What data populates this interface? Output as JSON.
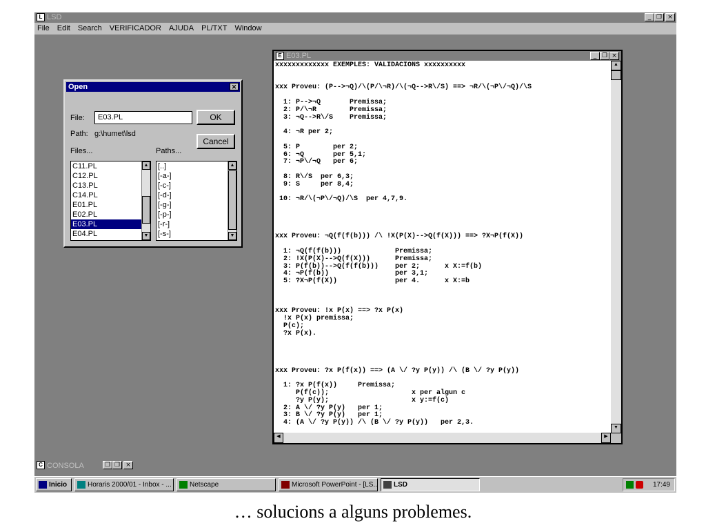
{
  "app": {
    "title": "LSD",
    "window_buttons": [
      "_",
      "❐",
      "×"
    ]
  },
  "menu": [
    "File",
    "Edit",
    "Search",
    "VERIFICADOR",
    "AJUDA",
    "PL/TXT",
    "Window"
  ],
  "open_dialog": {
    "title": "Open",
    "file_label": "File:",
    "file_value": "E03.PL",
    "path_label": "Path:",
    "path_value": "g:\\humet\\lsd",
    "files_label": "Files...",
    "paths_label": "Paths...",
    "ok_label": "OK",
    "cancel_label": "Cancel",
    "files": [
      "C11.PL",
      "C12.PL",
      "C13.PL",
      "C14.PL",
      "E01.PL",
      "E02.PL",
      "E03.PL",
      "E04.PL"
    ],
    "selected_file": "E03.PL",
    "paths": [
      "[..]",
      "[-a-]",
      "[-c-]",
      "[-d-]",
      "[-g-]",
      "[-p-]",
      "[-r-]",
      "[-s-]"
    ]
  },
  "editor": {
    "title": "E03.PL",
    "lines": [
      "xxxxxxxxxxxxx EXEMPLES: VALIDACIONS xxxxxxxxxx",
      "",
      "",
      "xxx Proveu: (P-->¬Q)/\\(P/\\¬R)/\\(¬Q-->R\\/S) ==> ¬R/\\(¬P\\/¬Q)/\\S",
      "",
      "  1: P-->¬Q       Premissa;",
      "  2: P/\\¬R        Premissa;",
      "  3: ¬Q-->R\\/S    Premissa;",
      "",
      "  4: ¬R per 2;",
      "",
      "  5: P        per 2;",
      "  6: ¬Q       per 5,1;",
      "  7: ¬P\\/¬Q   per 6;",
      "",
      "  8: R\\/S  per 6,3;",
      "  9: S     per 8,4;",
      "",
      " 10: ¬R/\\(¬P\\/¬Q)/\\S  per 4,7,9.",
      "",
      "",
      "",
      "",
      "xxx Proveu: ¬Q(f(f(b))) /\\ !X(P(X)-->Q(f(X))) ==> ?X¬P(f(X))",
      "",
      "  1: ¬Q(f(f(b)))             Premissa;",
      "  2: !X(P(X)-->Q(f(X)))      Premissa;",
      "  3: P(f(b))-->Q(f(f(b)))    per 2;      x X:=f(b)",
      "  4: ¬P(f(b))                per 3,1;",
      "  5: ?X¬P(f(X))              per 4.      x X:=b",
      "",
      "",
      "",
      "xxx Proveu: !x P(x) ==> ?x P(x)",
      "  !x P(x) premissa;",
      "  P(c);",
      "  ?x P(x).",
      "",
      "",
      "",
      "",
      "xxx Proveu: ?x P(f(x)) ==> (A \\/ ?y P(y)) /\\ (B \\/ ?y P(y))",
      "",
      "  1: ?x P(f(x))     Premissa;",
      "     P(f(c));                    x per algun c",
      "     ?y P(y);                    x y:=f(c)",
      "  2: A \\/ ?y P(y)   per 1;",
      "  3: B \\/ ?y P(y)   per 1;",
      "  4: (A \\/ ?y P(y)) /\\ (B \\/ ?y P(y))   per 2,3."
    ]
  },
  "consola": {
    "title": "CONSOLA"
  },
  "taskbar": {
    "start": "Inicio",
    "items": [
      {
        "label": "Horaris 2000/01 - Inbox - ..."
      },
      {
        "label": "Netscape"
      },
      {
        "label": "Microsoft PowerPoint - [LS..."
      },
      {
        "label": "LSD"
      }
    ],
    "clock": "17:49"
  },
  "caption": "… solucions a alguns problemes."
}
